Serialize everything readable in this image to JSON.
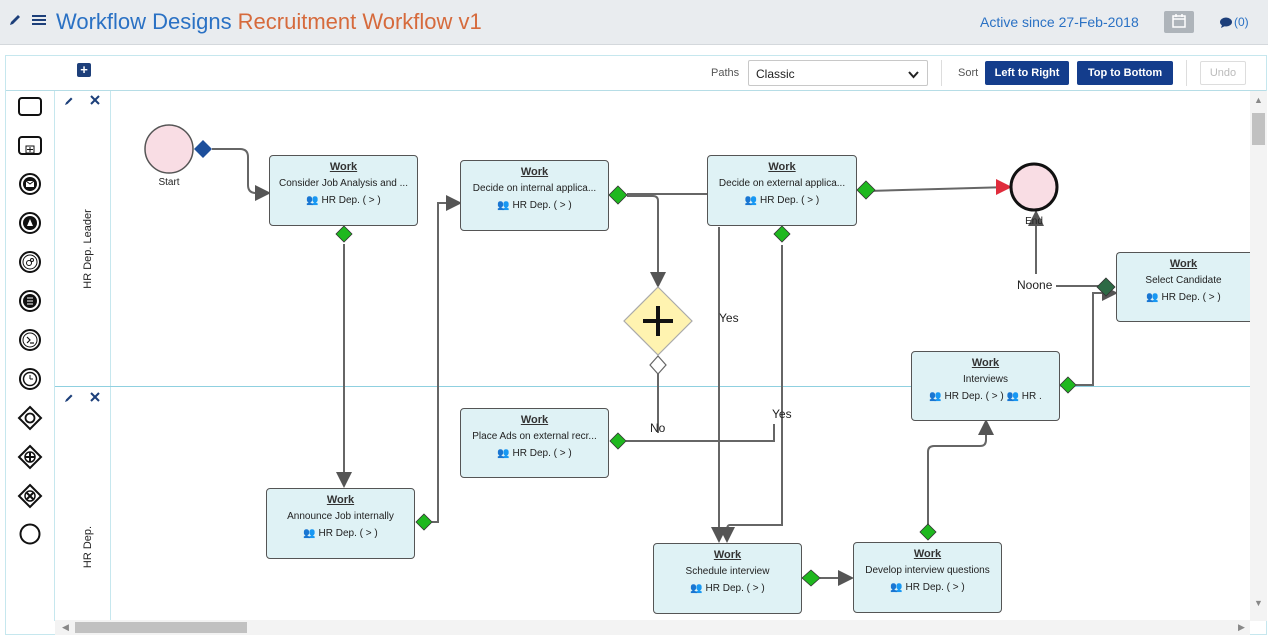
{
  "header": {
    "section_title": "Workflow Designs",
    "workflow_name": "Recruitment Workflow v1",
    "active_since": "Active since 27-Feb-2018",
    "comments_count": "(0)"
  },
  "toolbar": {
    "paths_label": "Paths",
    "paths_value": "Classic",
    "sort_label": "Sort",
    "left_to_right": "Left to Right",
    "top_to_bottom": "Top to Bottom",
    "undo": "Undo"
  },
  "palette": [
    "task-shape-icon",
    "subprocess-shape-icon",
    "message-event-icon",
    "signal-event-icon",
    "link-event-icon",
    "condition-event-icon",
    "escalation-event-icon",
    "timer-event-icon",
    "inclusive-gateway-icon",
    "parallel-gateway-icon",
    "exclusive-gateway-icon",
    "end-event-icon"
  ],
  "lanes": [
    {
      "label": "HR Dep. Leader"
    },
    {
      "label": "HR Dep."
    }
  ],
  "events": {
    "start": "Start",
    "end": "End"
  },
  "nodes": [
    {
      "title": "Work",
      "desc": "Consider Job Analysis and ...",
      "role": "HR Dep. ( > )",
      "role_icon": "user-pair-icon"
    },
    {
      "title": "Work",
      "desc": "Decide on internal applica...",
      "role": "HR Dep. ( > )",
      "role_icon": "user-pair-icon"
    },
    {
      "title": "Work",
      "desc": "Decide on external applica...",
      "role": "HR Dep. ( > )",
      "role_icon": "user-pair-icon"
    },
    {
      "title": "Work",
      "desc": "Select Candidate",
      "role": "HR Dep. ( > )",
      "role_icon": "user-pair-icon"
    },
    {
      "title": "Work",
      "desc": "Place Ads on external recr...",
      "role": "HR Dep. ( > )",
      "role_icon": "group-icon"
    },
    {
      "title": "Work",
      "desc": "Interviews",
      "role": "HR Dep. ( > )",
      "role2": "HR .",
      "role_icon": "group-icon"
    },
    {
      "title": "Work",
      "desc": "Announce Job internally",
      "role": "HR Dep. ( > )",
      "role_icon": "group-icon"
    },
    {
      "title": "Work",
      "desc": "Schedule interview",
      "role": "HR Dep. ( > )",
      "role_icon": "group-icon"
    },
    {
      "title": "Work",
      "desc": "Develop interview questions",
      "role": "HR Dep. ( > )",
      "role_icon": "group-icon"
    }
  ],
  "edge_labels": {
    "yes1": "Yes",
    "yes2": "Yes",
    "no": "No",
    "noone": "Noone"
  },
  "colors": {
    "accent": "#2a71c4",
    "workflow_name": "#d66a3c",
    "button": "#143d8c",
    "node_fill": "#dff2f5",
    "gateway_green": "#1fb81f",
    "parallel_gateway": "#fff3b0",
    "event_fill": "#f9dde4"
  }
}
